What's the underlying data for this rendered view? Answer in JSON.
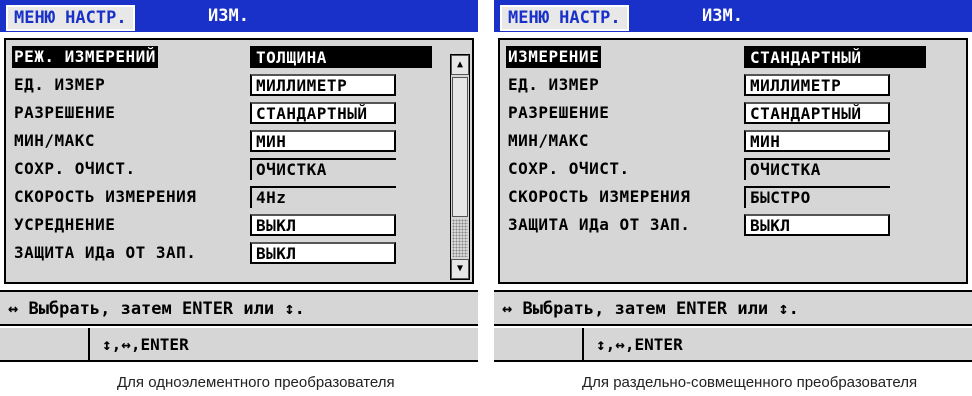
{
  "screens": [
    {
      "menu_tab": "МЕНЮ НАСТР.",
      "title": "ИЗМ.",
      "rows": [
        {
          "label": "РЕЖ. ИЗМЕРЕНИЙ",
          "value": "ТОЛЩИНА",
          "state": "active"
        },
        {
          "label": "ЕД. ИЗМЕР",
          "value": "МИЛЛИМЕТР",
          "state": "white"
        },
        {
          "label": "РАЗРЕШЕНИЕ",
          "value": "СТАНДАРТНЫЙ",
          "state": "white"
        },
        {
          "label": "МИН/МАКС",
          "value": "МИН",
          "state": "white"
        },
        {
          "label": "СОХР. ОЧИСТ.",
          "value": "ОЧИСТКА",
          "state": "gray"
        },
        {
          "label": "СКОРОСТЬ ИЗМЕРЕНИЯ",
          "value": "4Hz",
          "state": "gray"
        },
        {
          "label": "УСРЕДНЕНИЕ",
          "value": "ВЫКЛ",
          "state": "white"
        },
        {
          "label": "ЗАЩИТА ИДа ОТ ЗАП.",
          "value": "ВЫКЛ",
          "state": "white"
        }
      ],
      "help_text": "↔ Выбрать, затем ENTER или ↕.",
      "keys_text": "↕,↔,ENTER",
      "caption": "Для одноэлементного преобразователя"
    },
    {
      "menu_tab": "МЕНЮ НАСТР.",
      "title": "ИЗМ.",
      "rows": [
        {
          "label": "ИЗМЕРЕНИЕ",
          "value": "СТАНДАРТНЫЙ",
          "state": "active"
        },
        {
          "label": "ЕД. ИЗМЕР",
          "value": "МИЛЛИМЕТР",
          "state": "white"
        },
        {
          "label": "РАЗРЕШЕНИЕ",
          "value": "СТАНДАРТНЫЙ",
          "state": "white"
        },
        {
          "label": "МИН/МАКС",
          "value": "МИН",
          "state": "white"
        },
        {
          "label": "СОХР. ОЧИСТ.",
          "value": "ОЧИСТКА",
          "state": "gray"
        },
        {
          "label": "СКОРОСТЬ ИЗМЕРЕНИЯ",
          "value": "БЫСТРО",
          "state": "gray"
        },
        {
          "label": "ЗАЩИТА ИДа ОТ ЗАП.",
          "value": "ВЫКЛ",
          "state": "white"
        }
      ],
      "help_text": "↔ Выбрать, затем ENTER или ↕.",
      "keys_text": "↕,↔,ENTER",
      "caption": "Для раздельно-совмещенного преобразователя"
    }
  ],
  "colors": {
    "titlebar": "#1a31c9",
    "panel": "#d6d6d6"
  }
}
